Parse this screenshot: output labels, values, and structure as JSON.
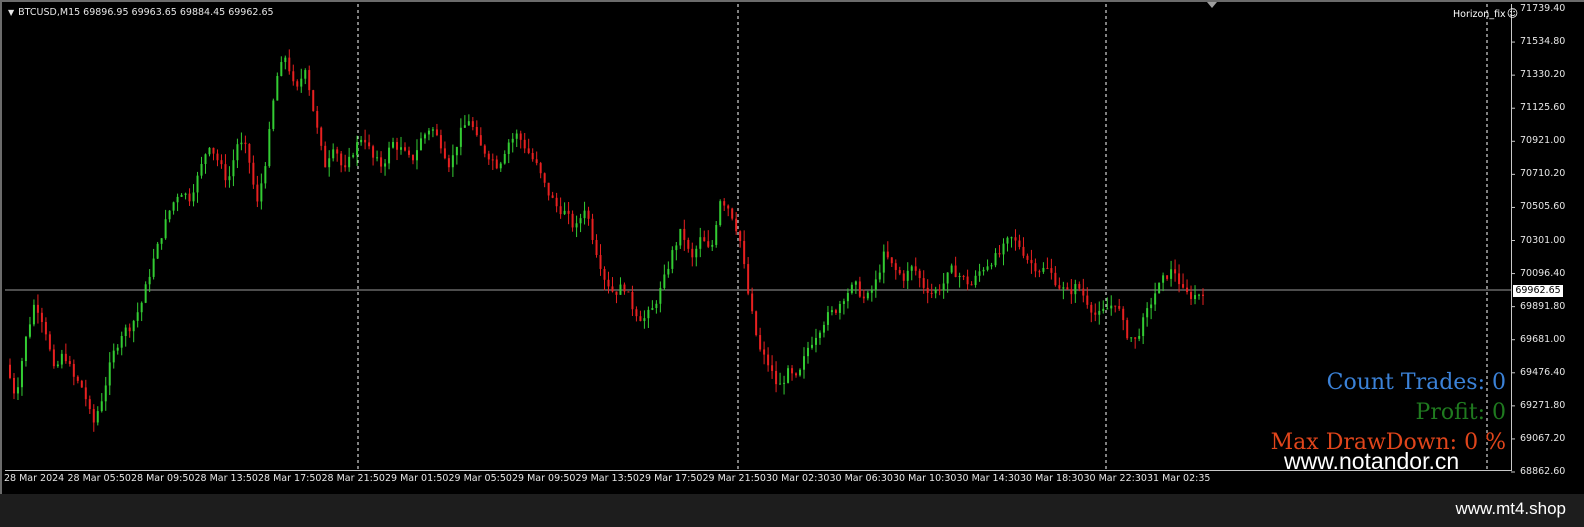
{
  "chart_header": {
    "symbol_line": "BTCUSD,M15  69896.95 69963.65 69884.45 69962.65",
    "indicator_label": "Horizon_fix"
  },
  "price_axis": {
    "labels": [
      "71739.40",
      "71534.80",
      "71330.20",
      "71125.60",
      "70921.00",
      "70710.20",
      "70505.60",
      "70301.00",
      "70096.40",
      "69891.80",
      "69681.00",
      "69476.40",
      "69271.80",
      "69067.20",
      "68862.60"
    ],
    "current_price": "69962.65"
  },
  "time_axis": {
    "labels": [
      "28 Mar 2024",
      "28 Mar 05:50",
      "28 Mar 09:50",
      "28 Mar 13:50",
      "28 Mar 17:50",
      "28 Mar 21:50",
      "29 Mar 01:50",
      "29 Mar 05:50",
      "29 Mar 09:50",
      "29 Mar 13:50",
      "29 Mar 17:50",
      "29 Mar 21:50",
      "30 Mar 02:30",
      "30 Mar 06:30",
      "30 Mar 10:30",
      "30 Mar 14:30",
      "30 Mar 18:30",
      "30 Mar 22:30",
      "31 Mar 02:35"
    ]
  },
  "stats": {
    "count_trades": "Count Trades: 0",
    "profit": "Profit: 0",
    "max_drawdown": "Max DrawDown: 0 %"
  },
  "watermarks": {
    "chart": "www.notandor.cn",
    "footer": "www.mt4.shop"
  },
  "colors": {
    "bull": "#33cc33",
    "bear": "#e82020",
    "background": "#000000",
    "grid_dashed": "#ffffff"
  },
  "chart_data": {
    "type": "candlestick",
    "title": "BTCUSD,M15",
    "ylim": [
      68862.6,
      71739.4
    ],
    "current_price": 69962.65,
    "closes": [
      69500,
      69300,
      69650,
      69900,
      69750,
      69450,
      69580,
      69420,
      69350,
      69120,
      69300,
      69550,
      69700,
      69750,
      69880,
      70100,
      70300,
      70480,
      70600,
      70550,
      70700,
      70900,
      70780,
      70650,
      70900,
      70850,
      70500,
      70820,
      71300,
      71450,
      71200,
      71380,
      71050,
      70750,
      70900,
      70700,
      70850,
      70950,
      70800,
      70750,
      70900,
      70850,
      70780,
      70920,
      71000,
      70900,
      70750,
      70950,
      71050,
      70880,
      70820,
      70750,
      70900,
      70950,
      70850,
      70750,
      70600,
      70500,
      70450,
      70350,
      70500,
      70250,
      70050,
      69950,
      70000,
      69850,
      69780,
      69850,
      70000,
      70200,
      70350,
      70150,
      70300,
      70200,
      70550,
      70480,
      70300,
      69900,
      69600,
      69500,
      69350,
      69450,
      69400,
      69600,
      69700,
      69800,
      69850,
      69950,
      70000,
      69900,
      70000,
      70200,
      70100,
      70050,
      70120,
      70000,
      69950,
      70000,
      70100,
      70050,
      70000,
      70100,
      70150,
      70200,
      70300,
      70250,
      70150,
      70100,
      70100,
      70000,
      69950,
      70000,
      69900,
      69800,
      69850,
      69900,
      69700,
      69650,
      69800,
      69950,
      70050,
      70100,
      69950,
      69930,
      69962.65
    ]
  }
}
